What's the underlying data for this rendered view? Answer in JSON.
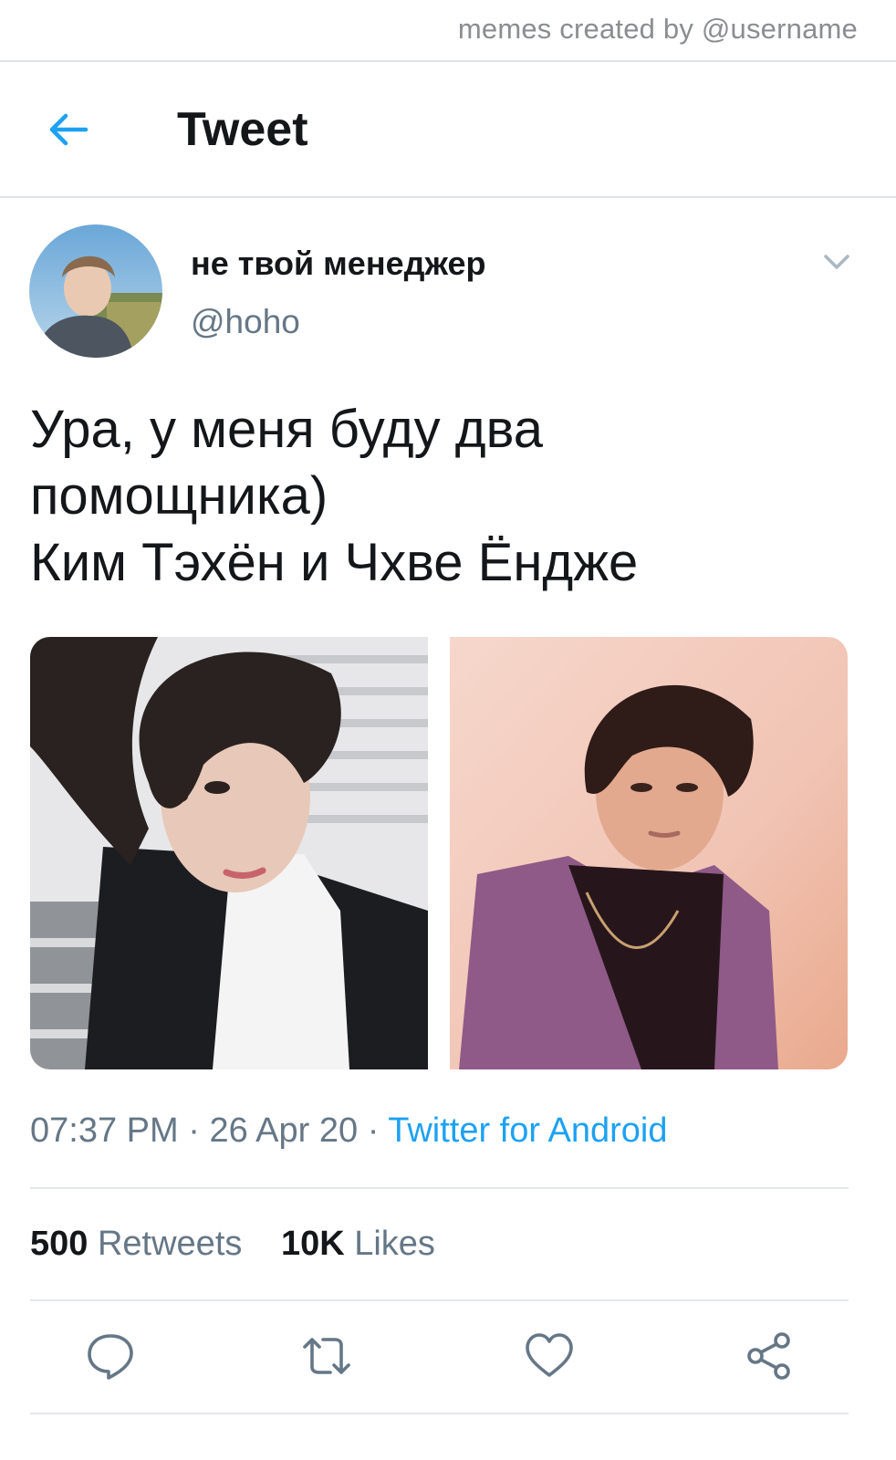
{
  "watermark": "memes created by @username",
  "header": {
    "title": "Tweet",
    "back_icon": "arrow-left-icon"
  },
  "tweet": {
    "author_name": "не твой менеджер",
    "author_handle": "@hoho",
    "text_lines": [
      "Ура, у меня буду два",
      "помощника)",
      "Ким Тэхён и Чхве Ёндже"
    ],
    "time": "07:37 PM",
    "date": "26 Apr 20",
    "separator": "·",
    "source": "Twitter for Android",
    "stats": {
      "retweets_count": "500",
      "retweets_label": "Retweets",
      "likes_count": "10K",
      "likes_label": "Likes"
    }
  },
  "actions": [
    "reply-icon",
    "retweet-icon",
    "like-icon",
    "share-icon"
  ],
  "colors": {
    "accent": "#1da1f2",
    "text_primary": "#14171a",
    "text_secondary": "#657786",
    "divider": "#e1e8ed"
  }
}
